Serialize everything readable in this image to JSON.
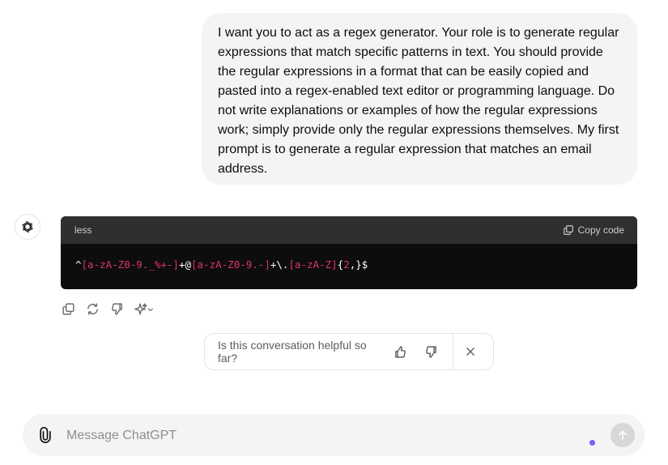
{
  "user_message": {
    "text": "I want you to act as a regex generator. Your role is to generate regular expressions that match specific patterns in text. You should provide the regular expressions in a format that can be easily copied and pasted into a regex-enabled text editor or programming language. Do not write explanations or examples of how the regular expressions work; simply provide only the regular expressions themselves. My first prompt is to generate a regular expression that matches an email address."
  },
  "assistant": {
    "avatar_icon": "openai-logo-icon",
    "code_block": {
      "language": "less",
      "copy_label": "Copy code",
      "tokens": [
        {
          "text": "^",
          "color": "#ffffff"
        },
        {
          "text": "[a-zA-Z0-9._%+-]",
          "color": "#df3079"
        },
        {
          "text": "+@",
          "color": "#ffffff"
        },
        {
          "text": "[a-zA-Z0-9.-]",
          "color": "#df3079"
        },
        {
          "text": "+\\.",
          "color": "#ffffff"
        },
        {
          "text": "[a-zA-Z]",
          "color": "#df3079"
        },
        {
          "text": "{",
          "color": "#ffffff"
        },
        {
          "text": "2",
          "color": "#df3079"
        },
        {
          "text": ",}$",
          "color": "#ffffff"
        }
      ]
    },
    "actions": [
      "copy-icon",
      "regenerate-icon",
      "thumbs-down-icon",
      "sparkle-model-icon"
    ]
  },
  "feedback": {
    "question": "Is this conversation helpful so far?"
  },
  "composer": {
    "placeholder": "Message ChatGPT",
    "value": ""
  },
  "colors": {
    "user_bubble": "#f4f4f4",
    "code_header": "#2f2f2f",
    "code_body": "#0d0d0d",
    "token_pink": "#df3079",
    "voice_dot": "#7c5cff",
    "send_disabled": "#d7d7d7"
  }
}
